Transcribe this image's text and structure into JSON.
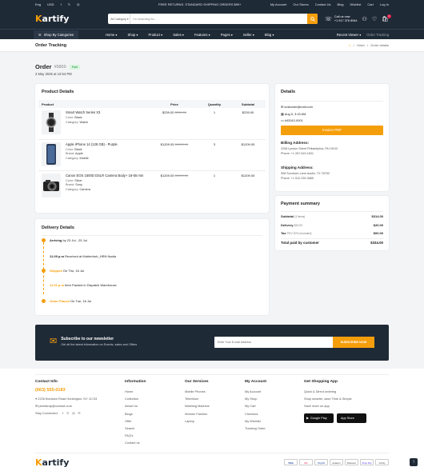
{
  "topbar": {
    "lang": "Eng",
    "currency": "USD",
    "promo": "FREE RETURNS. STANDARD SHIPPING ORDERS $99+",
    "links": [
      "My Account",
      "Our Stores",
      "Contact Us",
      "Blog",
      "Wishlist",
      "Cart",
      "Log In"
    ]
  },
  "header": {
    "logo": "artify",
    "logo_letter": "K",
    "search_category": "All Category",
    "search_placeholder": "I'm searching for...",
    "call_label": "Call us now",
    "call_number": "+1 917 376 8944",
    "cart_count": "0"
  },
  "nav": {
    "shop_by_categories": "Shop By Categories",
    "items": [
      "Home",
      "Shop",
      "Product",
      "Sales",
      "Features",
      "Pages",
      "Seller",
      "Blog"
    ],
    "recent_viewer": "Recent Viewer",
    "order_tracking": "Order Tracking"
  },
  "breadcrumb": {
    "title": "Order Tracking",
    "path": [
      "Order",
      "Order details"
    ]
  },
  "order": {
    "label": "Order",
    "number": "#5869",
    "status": "Paid",
    "date": "2 May 2025 at 12:54 PM"
  },
  "product_details": {
    "title": "Product Details",
    "columns": [
      "Product",
      "Price",
      "Quantity",
      "Subtotal"
    ],
    "items": [
      {
        "name": "Smart Watch Series X3",
        "meta1_label": "Color:",
        "meta1": "Black",
        "meta2_label": "Category:",
        "meta2": "Watch",
        "meta3_label": "",
        "meta3": "",
        "price": "$239.00",
        "old_price": "$250.00",
        "qty": "1",
        "subtotal": "$239.00"
      },
      {
        "name": "Apple iPhone 14 (128 GB) - Purple",
        "meta1_label": "Color:",
        "meta1": "Black",
        "meta2_label": "Brand:",
        "meta2": "Apple",
        "meta3_label": "Category:",
        "meta3": "Mobile",
        "price": "$1209.05",
        "old_price": "$1300.00",
        "qty": "3",
        "subtotal": "$1209.05"
      },
      {
        "name": "Canon EOS 1500D DSLR Camera Body+ 18-55 mm",
        "meta1_label": "Color:",
        "meta1": "Silver",
        "meta2_label": "Brand:",
        "meta2": "Sony",
        "meta3_label": "Category:",
        "meta3": "Camera",
        "price": "$1209.05",
        "old_price": "$1300.00",
        "qty": "1",
        "subtotal": "$1209.05"
      }
    ]
  },
  "details": {
    "title": "Details",
    "email": "customer@mail.com",
    "date": "Aug 5, 3:15 AM",
    "id": "#42042-0001",
    "invoice_button": "Invoice PDF",
    "billing_title": "Billing Address:",
    "billing_address": "2208 Lyndon Street Philadelphia, PA 19103",
    "billing_phone": "Phone: +1 267-619-1631",
    "shipping_title": "Shipping Address:",
    "shipping_address": "908 Sundown Lane Austin, TX 78750",
    "shipping_phone": "Phone: +1 512-239-3685"
  },
  "payment": {
    "title": "Payment summary",
    "subtotal_label": "Subtotal",
    "subtotal_items": "(3 items)",
    "subtotal": "$314.00",
    "delivery_label": "Delivery",
    "delivery_value": "$20.00",
    "delivery": "$20.00",
    "tax_label": "Tax",
    "tax_note": "PDV 20% (Included)",
    "tax": "$00.00",
    "total_label": "Total paid by customer",
    "total": "$334.00"
  },
  "delivery": {
    "title": "Delivery Details",
    "steps": [
      {
        "label": "Arriving",
        "text": "by 23 Jul - 25 Jul"
      },
      {
        "label": "11.09 p.m",
        "text": "Received at Motherhub_HRN Nadia"
      },
      {
        "label": "Shipped",
        "text": "On Thu, 16 Jul"
      },
      {
        "label": "11.01 p.m",
        "text": "Item Packed in Dispatch Warehouse"
      },
      {
        "label": "Order Placed",
        "text": "On Tue, 16 Jul"
      }
    ]
  },
  "newsletter": {
    "title": "Subscribe to our newsletter",
    "subtitle": "Get all the latest information on Events, sales and Offers",
    "placeholder": "Enter Your E-mail Address",
    "button": "SUBSCRIBE NOW"
  },
  "footer": {
    "contact": {
      "title": "Contact Info",
      "phone": "(663) 555-0183",
      "address": "2226 Boxtown Road Huntington, NY 11743",
      "email": "pixelstrap@contact.com",
      "stay_connected": "Stay Connected :"
    },
    "information": {
      "title": "Information",
      "items": [
        "Home",
        "Collection",
        "About Us",
        "Blogs",
        "Offer",
        "Search",
        "FAQ's",
        "Contact us"
      ]
    },
    "services": {
      "title": "Our Services",
      "items": [
        "Mobile Phones",
        "Television",
        "Washing Machine",
        "Women Fashion",
        "Laptop"
      ]
    },
    "account": {
      "title": "My Account",
      "items": [
        "My Account",
        "My Shop",
        "My Cart",
        "Checkout",
        "My Wishlist",
        "Tracking Order"
      ]
    },
    "app": {
      "title": "Get Shopping App",
      "lines": [
        "Quick & Direct ordering",
        "Shop smarter, save Time & Simple",
        "Save more on app"
      ],
      "google_play": "Google Play",
      "app_store": "App Store"
    },
    "payments": [
      "VISA",
      "MC",
      "PayPal",
      "amazon",
      "Discover",
      "Shop Pay",
      "G Pay"
    ]
  },
  "colors": {
    "accent": "#f59e0b",
    "dark": "#1f2a37"
  }
}
